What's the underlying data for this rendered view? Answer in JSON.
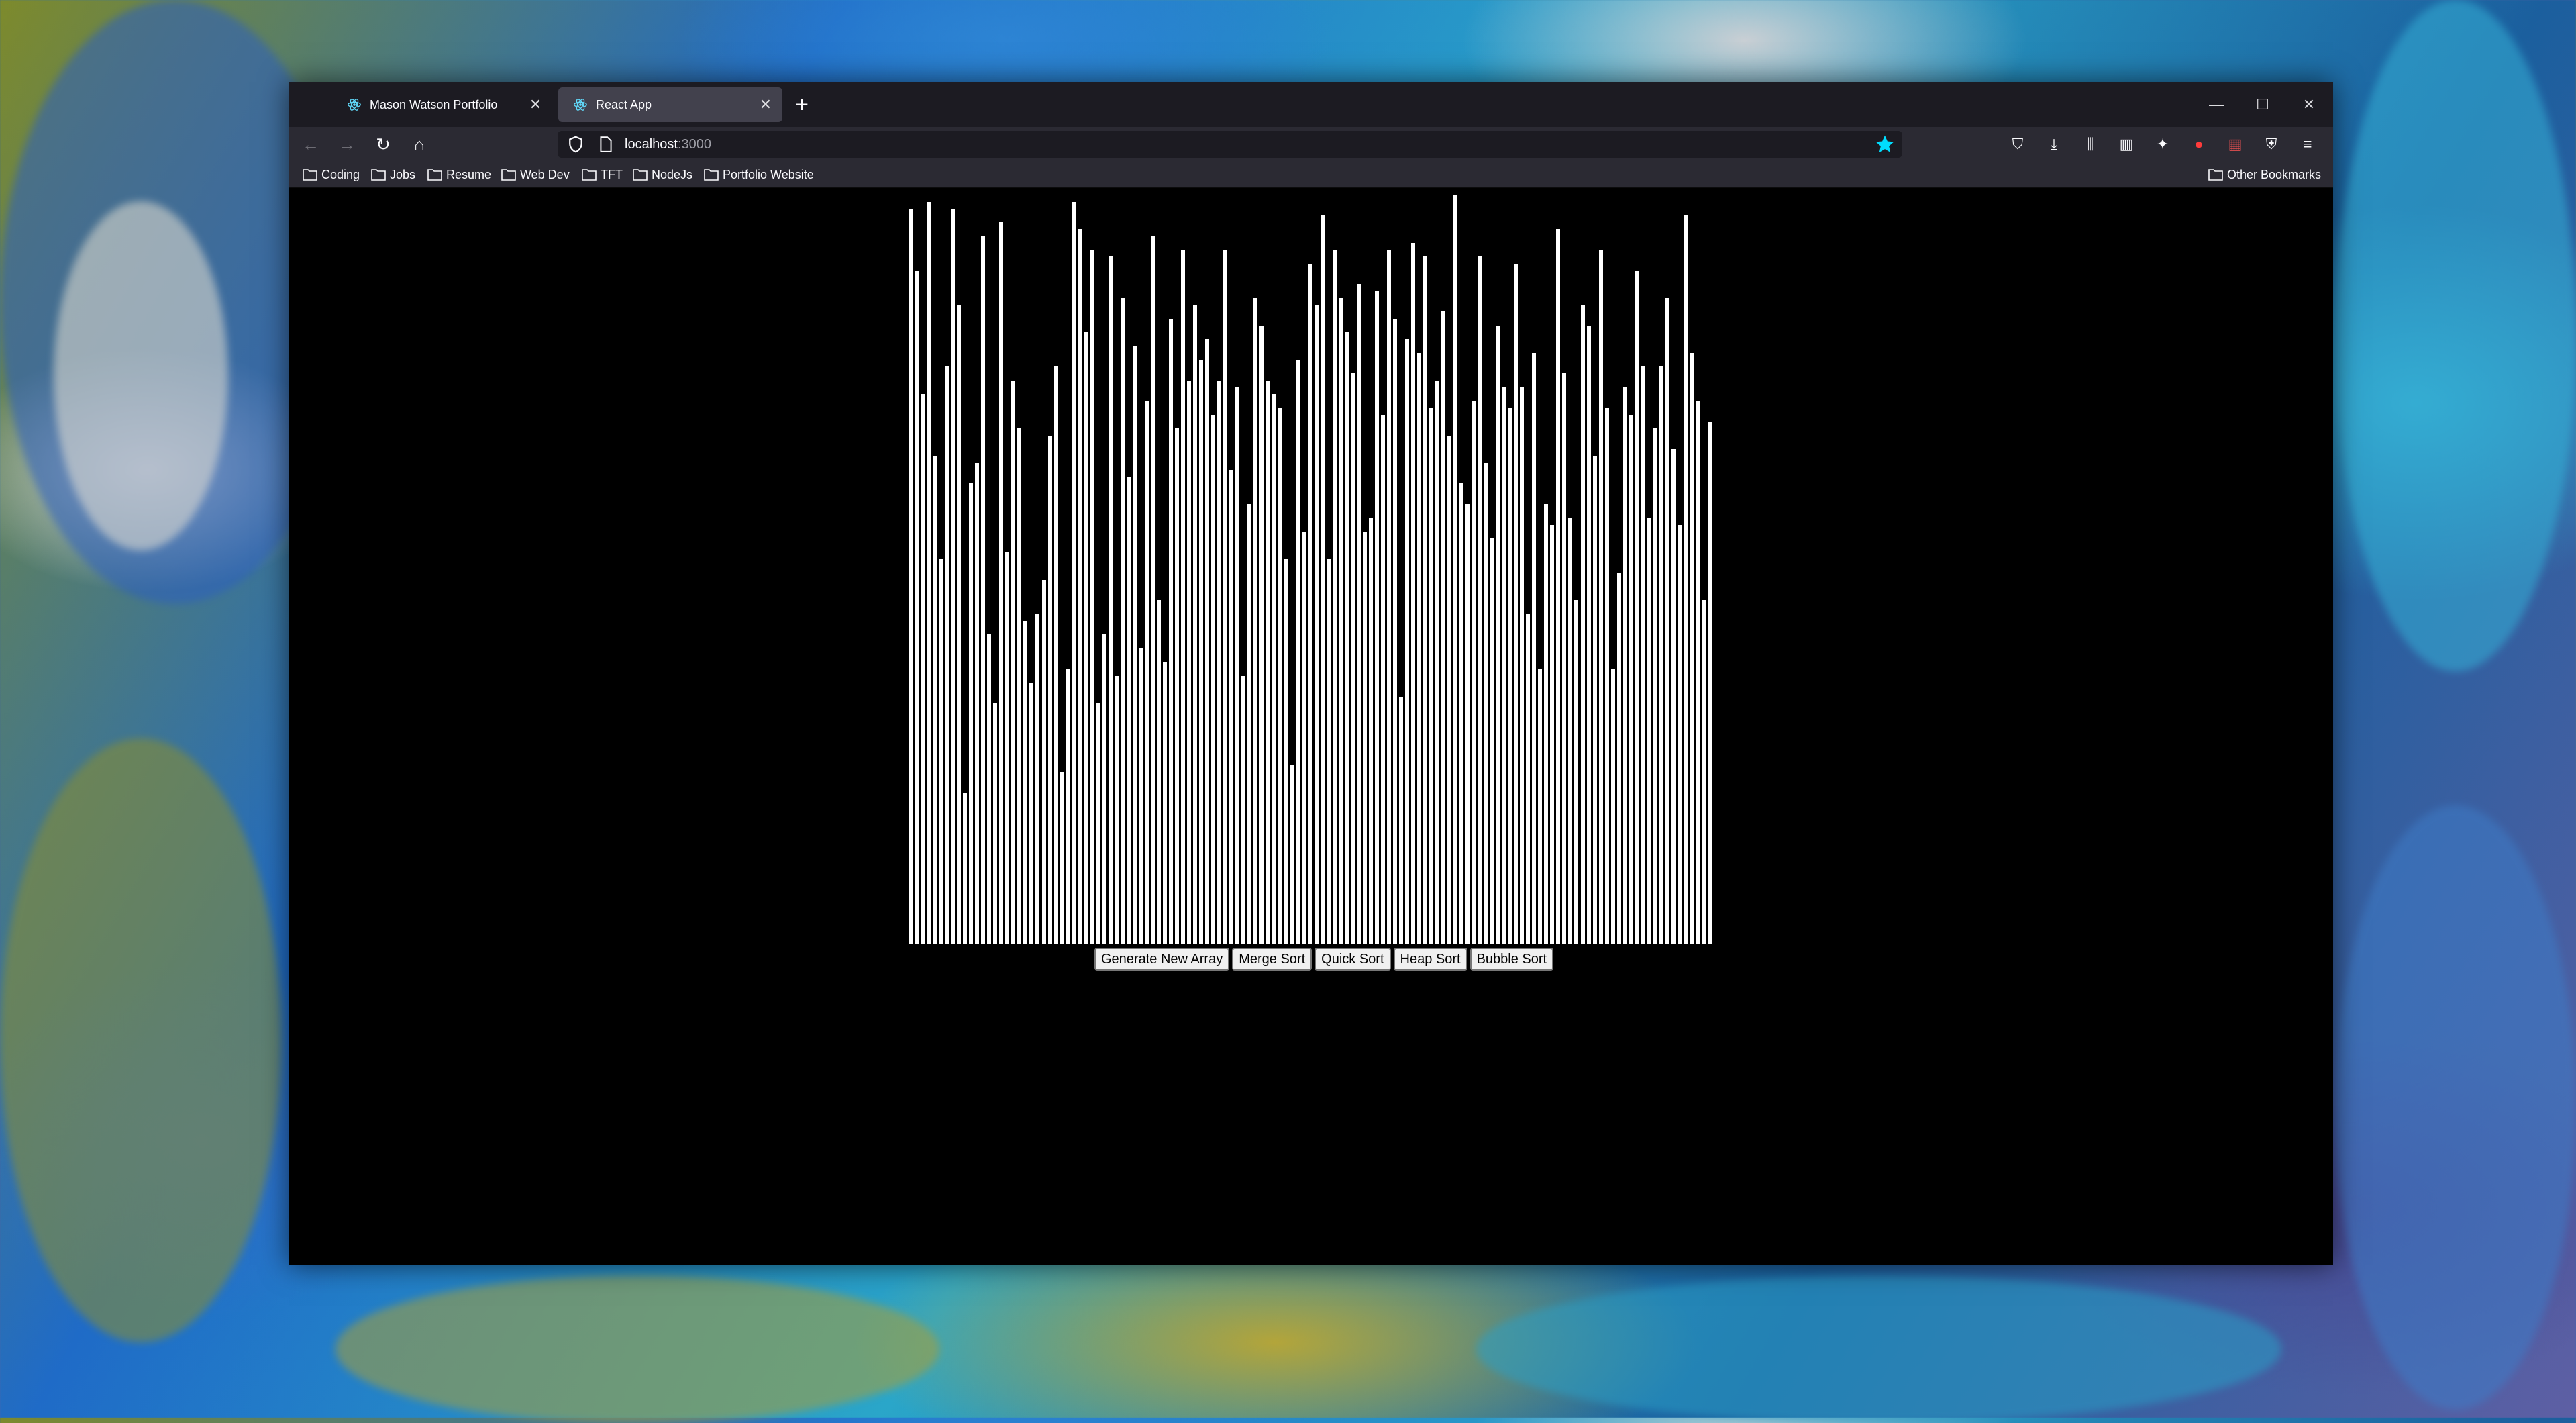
{
  "browser": {
    "tabs": [
      {
        "title": "Mason Watson Portfolio",
        "active": false
      },
      {
        "title": "React App",
        "active": true
      }
    ],
    "url": {
      "host": "localhost",
      "port": ":3000"
    },
    "bookmarks": [
      "Coding",
      "Jobs",
      "Resume",
      "Web Dev",
      "TFT",
      "NodeJs",
      "Portfolio Website"
    ],
    "other_bookmarks": "Other Bookmarks",
    "accent_color": "#00ddff"
  },
  "app": {
    "bar_color": "#ffffff",
    "background_color": "#000000",
    "buttons": {
      "generate": "Generate New Array",
      "merge": "Merge Sort",
      "quick": "Quick Sort",
      "heap": "Heap Sort",
      "bubble": "Bubble Sort"
    }
  },
  "chart_data": {
    "type": "bar",
    "title": "",
    "xlabel": "",
    "ylabel": "",
    "ylim": [
      0,
      1100
    ],
    "values": [
      1070,
      980,
      800,
      1080,
      710,
      560,
      840,
      1070,
      930,
      220,
      670,
      700,
      1030,
      450,
      350,
      1050,
      570,
      820,
      750,
      470,
      380,
      480,
      530,
      740,
      840,
      250,
      400,
      1080,
      1040,
      890,
      1010,
      350,
      450,
      1000,
      390,
      940,
      680,
      870,
      430,
      790,
      1030,
      500,
      410,
      910,
      750,
      1010,
      820,
      930,
      850,
      880,
      770,
      820,
      1010,
      690,
      810,
      390,
      640,
      940,
      900,
      820,
      800,
      780,
      560,
      260,
      850,
      600,
      990,
      930,
      1060,
      560,
      1010,
      940,
      890,
      830,
      960,
      600,
      620,
      950,
      770,
      1010,
      910,
      360,
      880,
      1020,
      860,
      1000,
      780,
      820,
      920,
      740,
      1090,
      670,
      640,
      790,
      1000,
      700,
      590,
      900,
      810,
      780,
      990,
      810,
      480,
      860,
      400,
      640,
      610,
      1040,
      830,
      620,
      500,
      930,
      900,
      710,
      1010,
      780,
      400,
      540,
      810,
      770,
      980,
      840,
      620,
      750,
      840,
      940,
      720,
      610,
      1060,
      860,
      790,
      500,
      760
    ]
  }
}
